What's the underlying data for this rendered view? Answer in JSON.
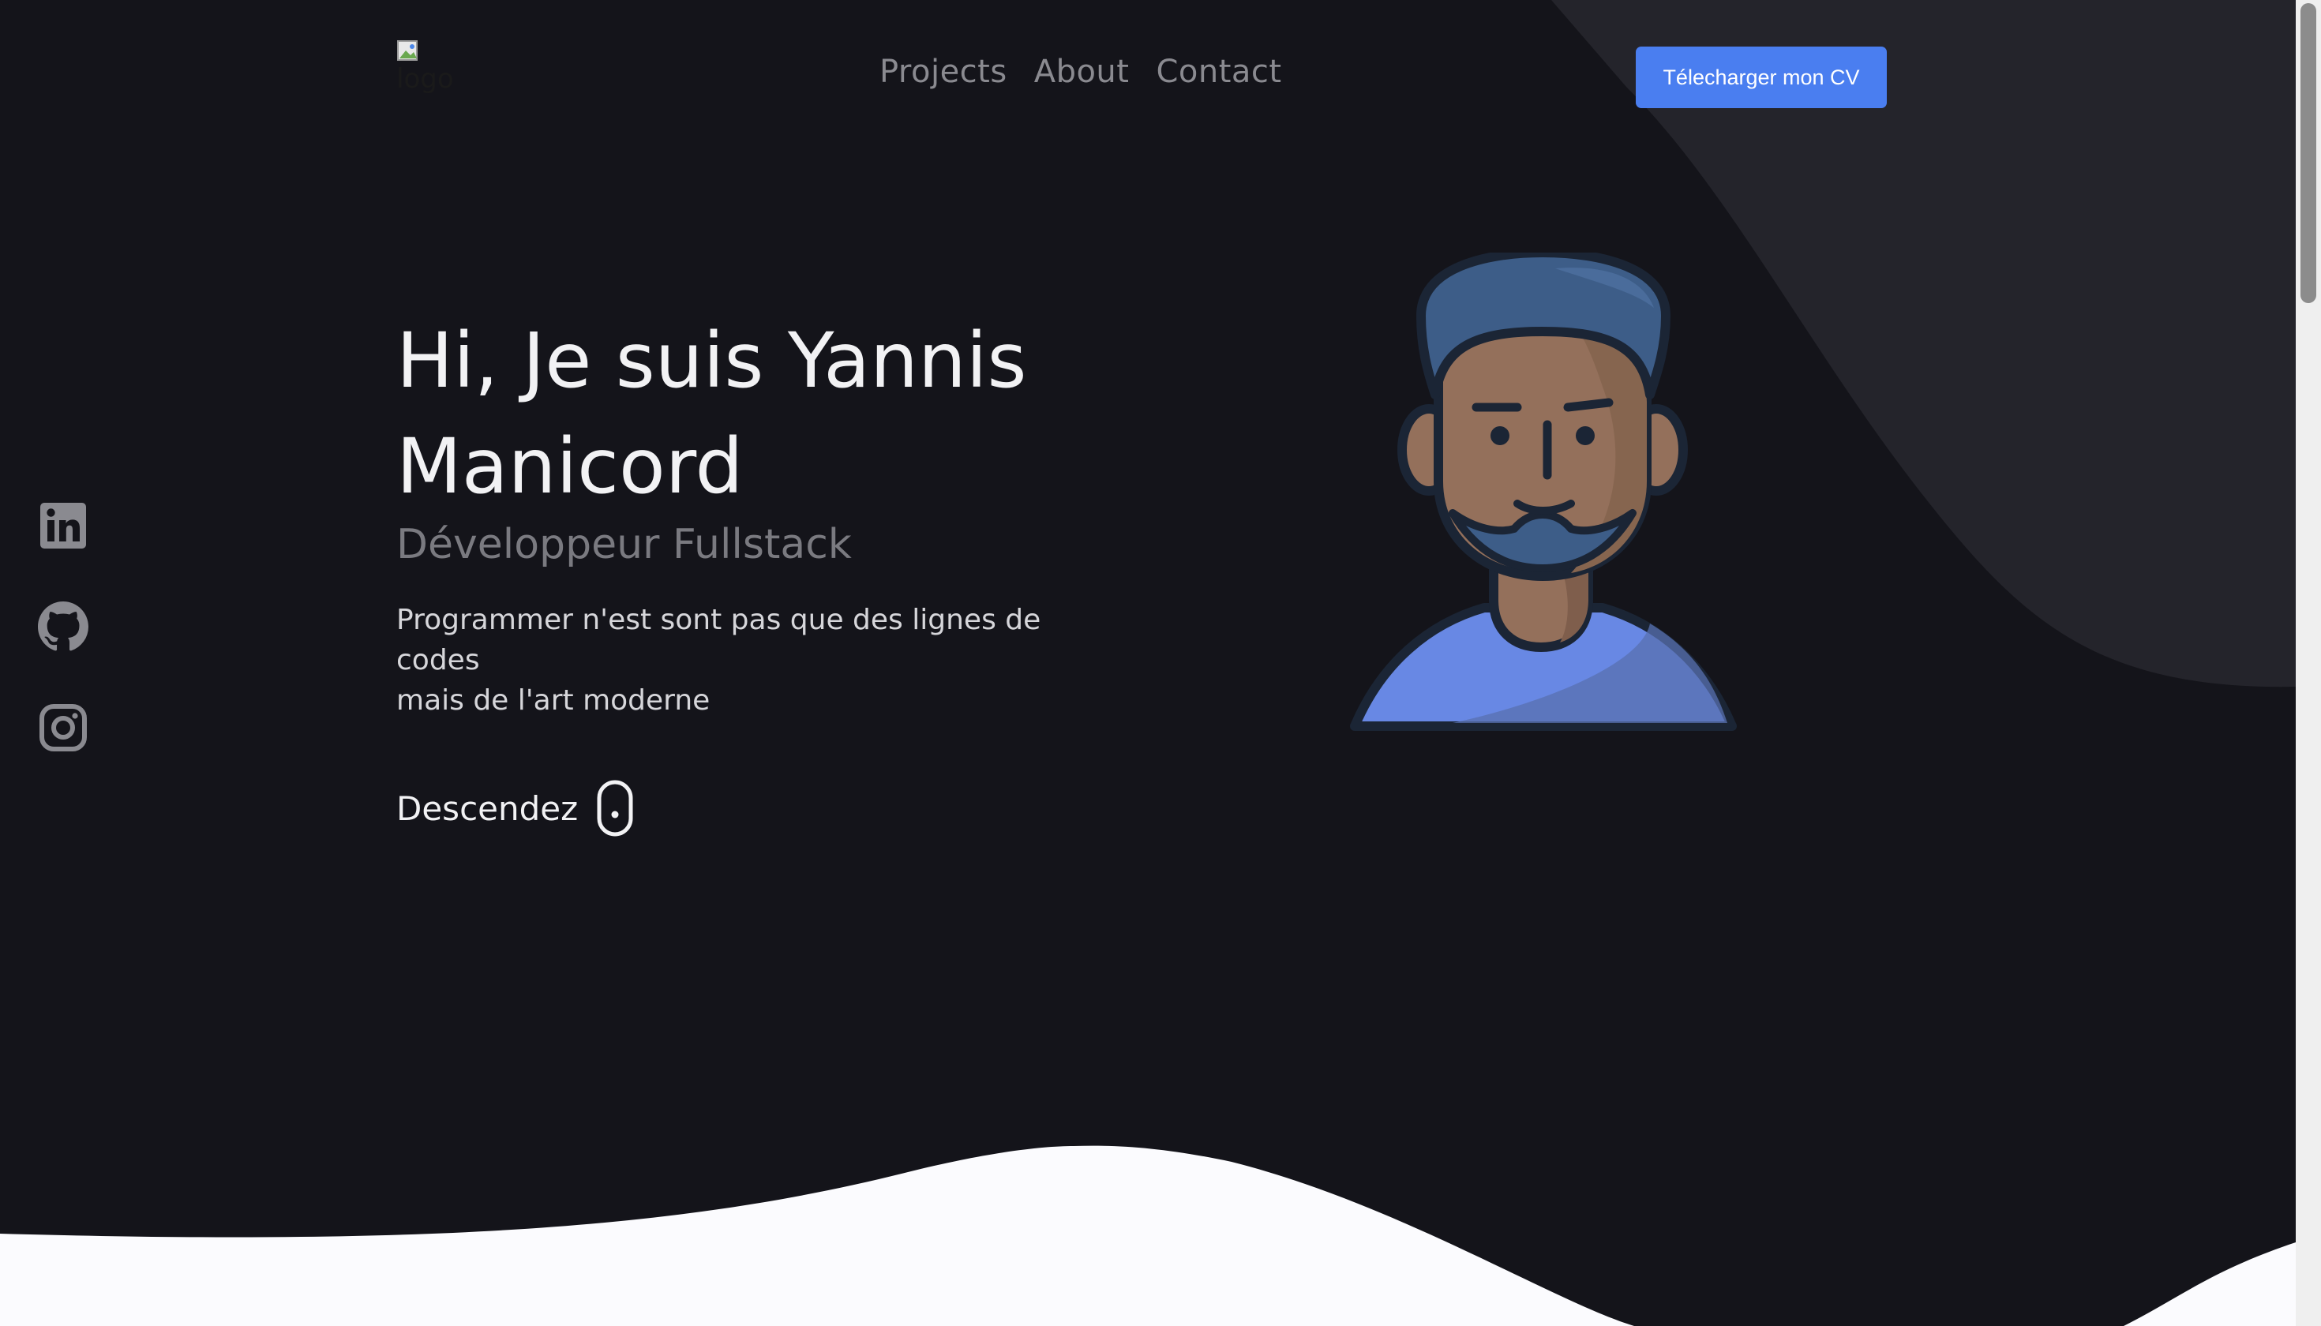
{
  "header": {
    "logo_alt": "logo",
    "nav": [
      {
        "label": "Projects"
      },
      {
        "label": "About"
      },
      {
        "label": "Contact"
      }
    ],
    "cv_button": "Télecharger mon CV"
  },
  "socials": [
    {
      "name": "LinkedIn",
      "icon": "linkedin-icon"
    },
    {
      "name": "GitHub",
      "icon": "github-icon"
    },
    {
      "name": "Instagram",
      "icon": "instagram-icon"
    }
  ],
  "hero": {
    "title_line1": "Hi, Je suis Yannis",
    "title_line2": "Manicord",
    "subtitle": "Développeur Fullstack",
    "description_line1": "Programmer n'est sont pas que des lignes de codes",
    "description_line2": "mais de l'art moderne",
    "scroll_label": "Descendez",
    "scroll_icon": "mouse-icon"
  },
  "colors": {
    "background": "#14141a",
    "accent_shape": "#24242b",
    "primary": "#4a7ef0",
    "muted_text": "#8a8a90",
    "wave": "#fbfbfe"
  }
}
